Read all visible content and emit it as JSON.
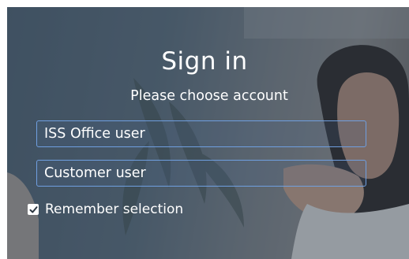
{
  "signin": {
    "title": "Sign in",
    "subtitle": "Please choose account",
    "accounts": [
      {
        "label": "ISS Office user"
      },
      {
        "label": "Customer user"
      }
    ],
    "remember": {
      "label": "Remember selection",
      "checked": true
    }
  },
  "colors": {
    "button_border": "#6f9fe0",
    "text": "#ffffff",
    "scrim": "#283a50"
  }
}
